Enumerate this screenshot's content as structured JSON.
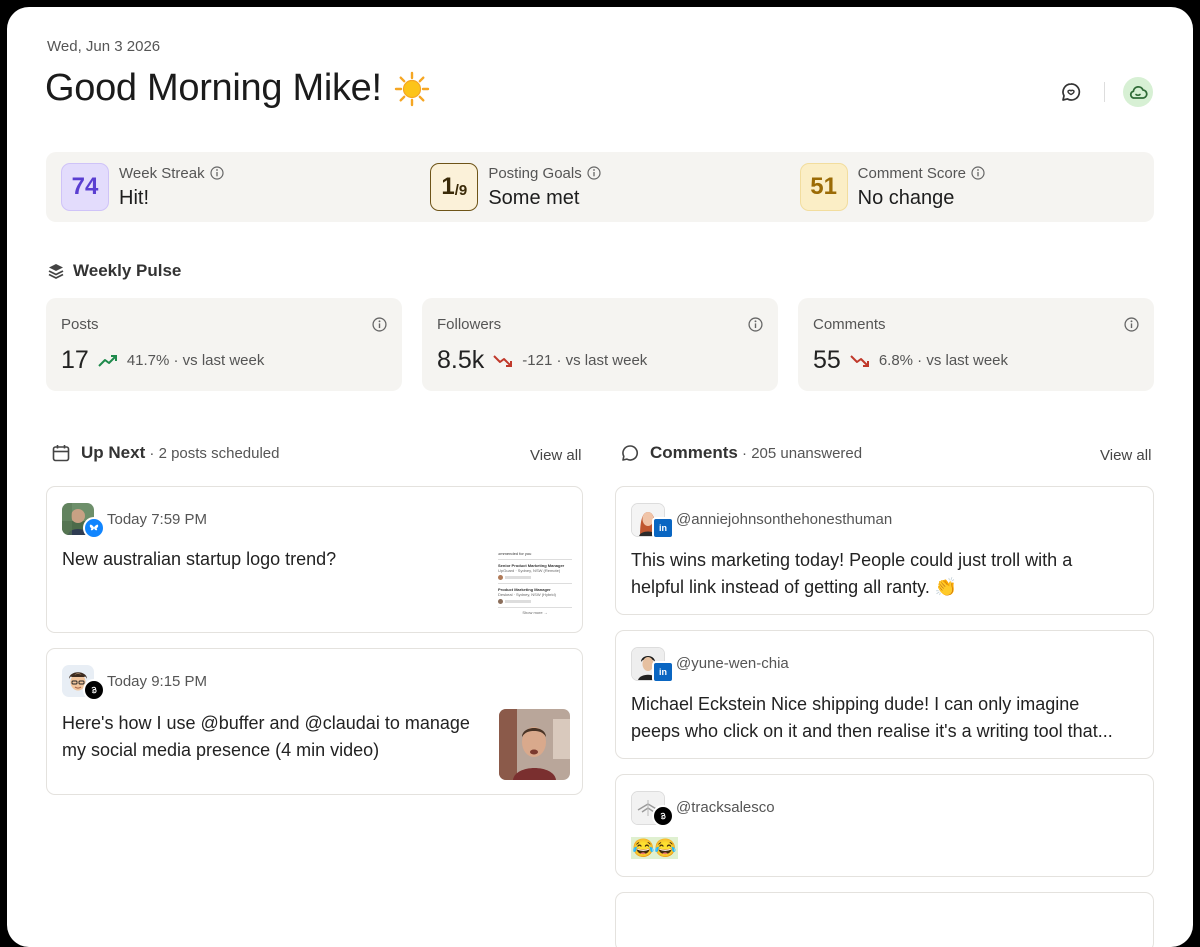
{
  "header": {
    "date": "Wed, Jun 3 2026",
    "greeting": "Good Morning Mike!"
  },
  "stats": [
    {
      "badge": "74",
      "label": "Week Streak",
      "value": "Hit!"
    },
    {
      "badge_main": "1",
      "badge_sub": "/9",
      "label": "Posting Goals",
      "value": "Some met"
    },
    {
      "badge": "51",
      "label": "Comment Score",
      "value": "No change"
    }
  ],
  "pulse": {
    "title": "Weekly Pulse",
    "cards": [
      {
        "title": "Posts",
        "value": "17",
        "delta": "41.7% · vs last week",
        "trend": "up",
        "color": "#1f8a4c"
      },
      {
        "title": "Followers",
        "value": "8.5k",
        "delta": "-121 · vs last week",
        "trend": "down",
        "color": "#c0392b"
      },
      {
        "title": "Comments",
        "value": "55",
        "delta": "6.8% · vs last week",
        "trend": "down",
        "color": "#c0392b"
      }
    ]
  },
  "upnext": {
    "title": "Up Next",
    "subtitle": "· 2 posts scheduled",
    "view_all": "View all",
    "posts": [
      {
        "time": "Today 7:59 PM",
        "text": "New australian startup logo trend?",
        "network": "bluesky"
      },
      {
        "time": "Today 9:15 PM",
        "text_line1": "Here's how I use @buffer and @claudai to manage",
        "text_line2": "my social media presence (4 min video)",
        "network": "threads"
      }
    ]
  },
  "comments": {
    "title": "Comments",
    "subtitle": "· 205 unanswered",
    "view_all": "View all",
    "items": [
      {
        "handle": "@anniejohnsonthehonesthuman",
        "line1": "This wins marketing today! People could just troll with a",
        "line2": "helpful link instead of getting all ranty. 👏",
        "network": "linkedin"
      },
      {
        "handle": "@yune-wen-chia",
        "line1": "Michael Eckstein Nice shipping dude! I can only imagine",
        "line2": "peeps who click on it and then realise it's a writing tool that...",
        "network": "linkedin"
      },
      {
        "handle": "@tracksalesco",
        "line1": "😂😂",
        "network": "threads"
      }
    ]
  },
  "thumb_preview": {
    "line0": "ommended for you",
    "job1": "Senior Product Marketing Manager",
    "job1_sub": "UpGuard · Sydney, NSW (Remote)",
    "job2": "Product Marketing Manager",
    "job2_sub": "Deskeal · Sydney, NSW (Hybrid)",
    "more": "Show more →"
  },
  "colors": {
    "accent_purple": "#5a3ed1",
    "gold": "#9b6b05",
    "green_bg": "#d7f0d4",
    "panel_bg": "#f5f4f1"
  }
}
